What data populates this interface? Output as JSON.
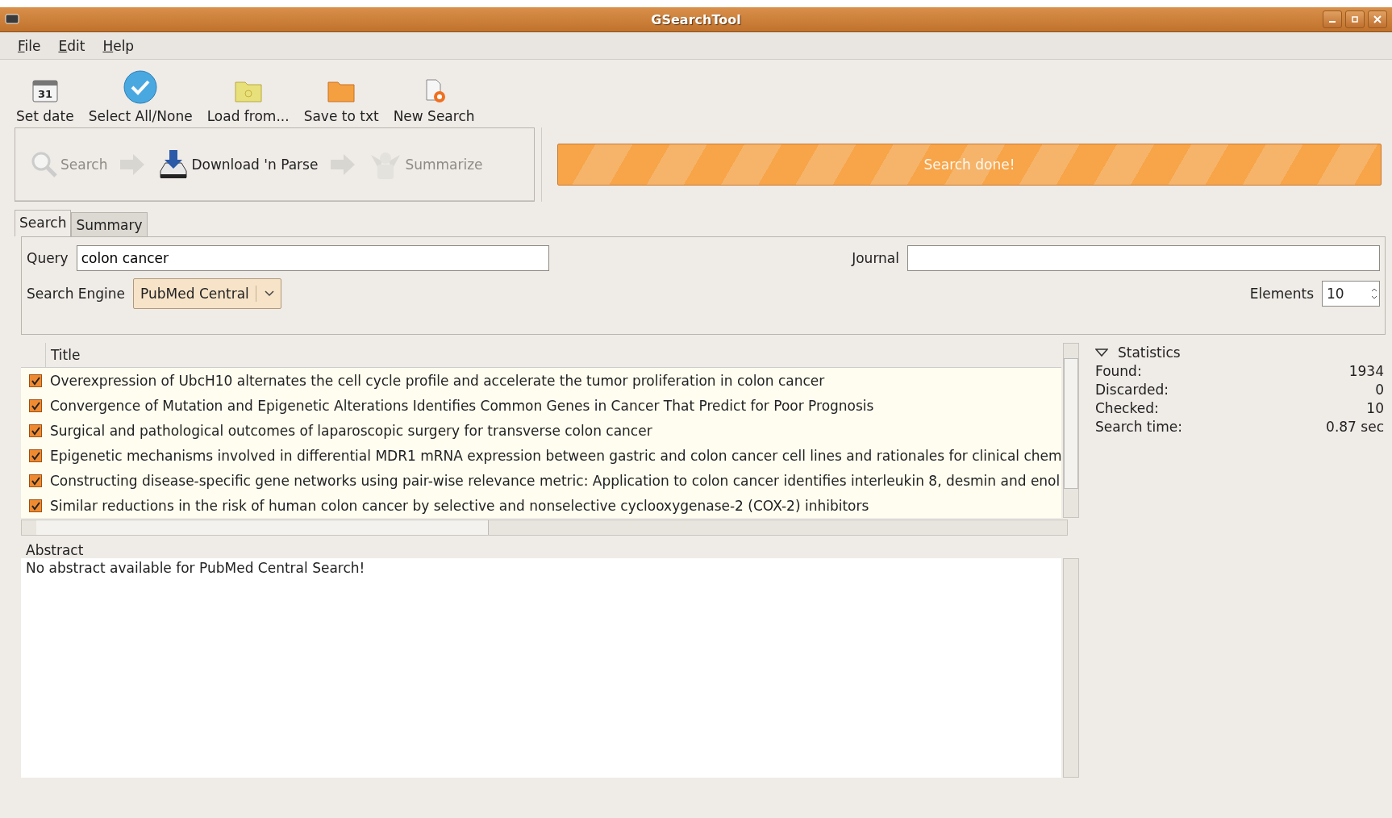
{
  "window": {
    "title": "GSearchTool"
  },
  "menu": [
    "File",
    "Edit",
    "Help"
  ],
  "toolbar": [
    {
      "kind": "calendar",
      "label": "Set date",
      "calendar_day": "31"
    },
    {
      "kind": "check",
      "label": "Select All/None"
    },
    {
      "kind": "folder-search",
      "label": "Load from..."
    },
    {
      "kind": "folder",
      "label": "Save to txt"
    },
    {
      "kind": "new",
      "label": "New Search"
    }
  ],
  "steps": [
    {
      "kind": "search",
      "label": "Search",
      "disabled": true
    },
    {
      "kind": "download",
      "label": "Download 'n Parse",
      "disabled": false
    },
    {
      "kind": "summarize",
      "label": "Summarize",
      "disabled": true
    }
  ],
  "progress": {
    "label": "Search done!",
    "level": 1
  },
  "tabs": [
    {
      "label": "Search",
      "selected": true
    },
    {
      "label": "Summary",
      "selected": false
    }
  ],
  "form": {
    "query_label": "Query",
    "query": "colon cancer",
    "journal_label": "Journal",
    "engine_label": "Search Engine",
    "engine": "PubMed Central",
    "elements_label": "Elements",
    "elements": "10"
  },
  "table": {
    "columns": [
      "Title"
    ],
    "rows": [
      {
        "checked": true,
        "title": "Overexpression of UbcH10 alternates the cell cycle profile and accelerate the tumor proliferation in colon cancer"
      },
      {
        "checked": true,
        "title": "Convergence of Mutation and Epigenetic Alterations Identifies Common Genes in Cancer That Predict for Poor Prognosis"
      },
      {
        "checked": true,
        "title": "Surgical and pathological outcomes of laparoscopic surgery for transverse colon cancer"
      },
      {
        "checked": true,
        "title": "Epigenetic mechanisms involved in differential MDR1 mRNA expression between gastric and colon cancer cell lines and rationales for clinical chem"
      },
      {
        "checked": true,
        "title": "Constructing disease-specific gene networks using pair-wise relevance metric: Application to colon cancer identifies interleukin 8, desmin and enol"
      },
      {
        "checked": true,
        "title": "Similar reductions in the risk of human colon cancer by selective and nonselective cyclooxygenase-2 (COX-2) inhibitors"
      }
    ]
  },
  "statistics": {
    "title": "Statistics",
    "expanded": true,
    "items": [
      {
        "label": "Found:",
        "value": "1934"
      },
      {
        "label": "Discarded:",
        "value": "0"
      },
      {
        "label": "Checked:",
        "value": "10"
      },
      {
        "label": "Search time:",
        "value": "0.87 sec"
      }
    ]
  },
  "abstract": {
    "label": "Abstract",
    "text": "No abstract available for PubMed Central Search!"
  }
}
